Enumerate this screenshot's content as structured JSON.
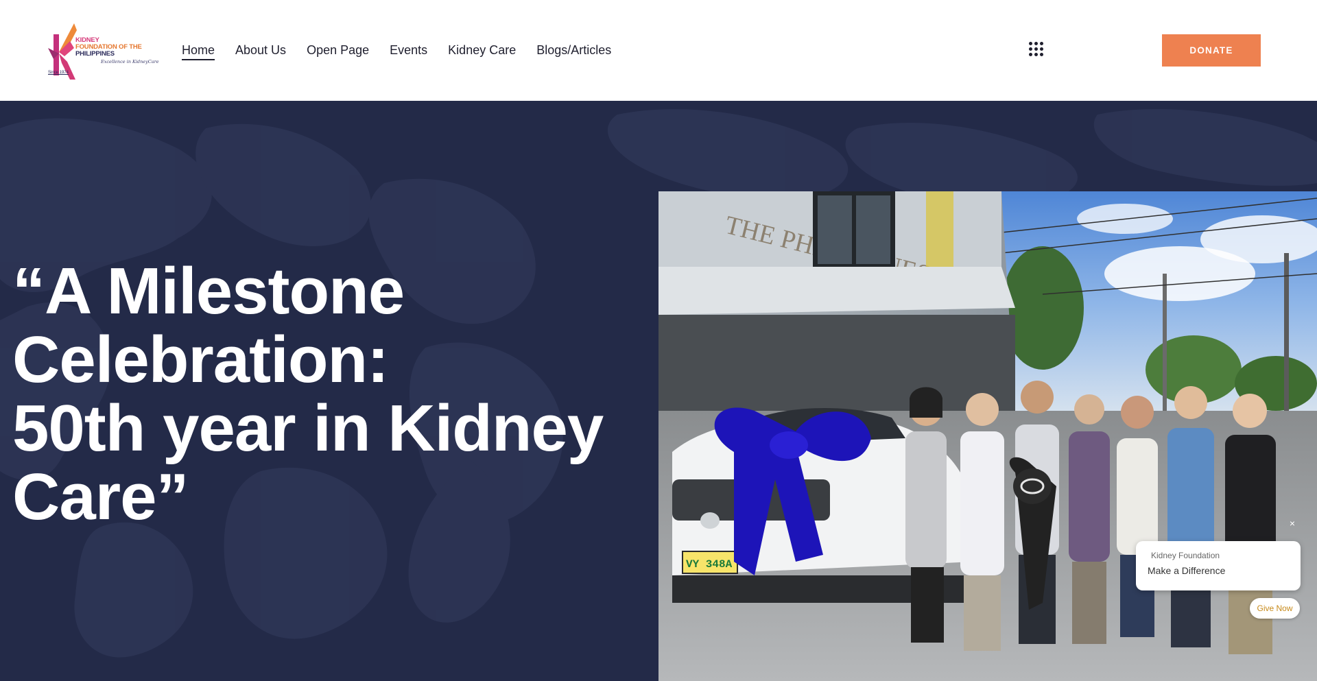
{
  "logo": {
    "line1": "KIDNEY",
    "line2": "FOUNDATION OF THE",
    "line3": "PHILIPPINES",
    "tagline": "Excellence in KidneyCare",
    "since": "Since 1974"
  },
  "nav": {
    "items": [
      {
        "label": "Home",
        "active": true
      },
      {
        "label": "About Us"
      },
      {
        "label": "Open Page"
      },
      {
        "label": "Events"
      },
      {
        "label": "Kidney Care"
      },
      {
        "label": "Blogs/Articles"
      }
    ],
    "menu_icon": "grid-menu-icon"
  },
  "header": {
    "donate_label": "DONATE",
    "donate_color": "#ee8150"
  },
  "hero": {
    "title_lines": [
      "“A Milestone",
      "Celebration:",
      "50th year in Kidney",
      "Care”"
    ],
    "background_color": "#232a48"
  },
  "photo": {
    "signage": "THE PHILIPPINES INC.",
    "plate": "VY 348A"
  },
  "chat_widget": {
    "close_label": "×",
    "org_name": "Kidney Foundation",
    "message": "Make a Difference ",
    "button_label": "Give Now"
  }
}
